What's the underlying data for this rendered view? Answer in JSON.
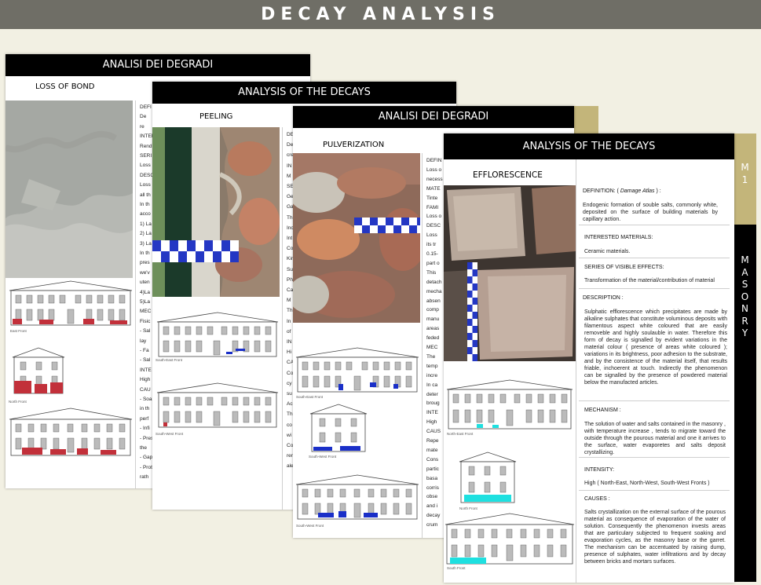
{
  "page_title": "DECAY ANALYSIS",
  "sheet1": {
    "header": "ANALISI DEI DEGRADI",
    "decay_name": "LOSS OF BOND",
    "fragments": [
      "DEFI",
      "De",
      "re",
      "INTERES",
      "Rend",
      "SERI",
      "Loss",
      "DESC",
      "Loss",
      "all th",
      "In th",
      "acco",
      "1) La",
      "2) La",
      "3) La",
      "In th",
      "pres",
      "we'v",
      "uten",
      "4)La",
      "5)La",
      "MEC",
      "Fisic",
      "- Sal",
      "lay",
      "- Fa",
      "- Sal",
      "INTE",
      "High",
      "CAU",
      "- Soa",
      "in th",
      "perf",
      "- Infi",
      "- Pres",
      "the",
      "- Gap",
      "- Prot",
      "rath"
    ],
    "captions": [
      "East Front",
      "North Front"
    ]
  },
  "sheet2": {
    "header": "ANALYSIS OF THE DECAYS",
    "decay_name": "PEELING",
    "fragments": [
      "DEFI",
      "Det",
      "cre",
      "IN",
      "M",
      "SE",
      "Ge",
      "Ga",
      "Th",
      "Inc",
      "Int",
      "Co",
      "Kin",
      "Sur",
      "Ph",
      "Ca",
      "M",
      "Th",
      "In",
      "of",
      "IN",
      "Hi",
      "CA",
      "Co",
      "cy",
      "su",
      "Ac",
      "Th",
      "co",
      "wi",
      "Co",
      "ren",
      "ale"
    ],
    "captions": [
      "South-East Front",
      "South-West Front"
    ]
  },
  "sheet3": {
    "header": "ANALISI DEI DEGRADI",
    "decay_name": "PULVERIZATION",
    "fragments": [
      "DEFIN",
      "Loss o",
      "necess",
      "MATE",
      "Tinte",
      "FAMI",
      "Loss o",
      "DESC",
      "Loss",
      "its tr",
      "0.15-",
      "part o",
      "This",
      "detach",
      "mecha",
      "absen",
      "comp",
      "manu",
      "areas",
      "feded",
      "MEC",
      "The",
      "temp",
      "incre",
      "In ca",
      "deter",
      "broug",
      "INTE",
      "High",
      "CAUS",
      "Repe",
      "mate",
      "Cons",
      "partic",
      "basa",
      "corris",
      "obse",
      "and i",
      "decay",
      "crum"
    ],
    "captions": [
      "South-East Front",
      "South-West Front",
      "South-West Front"
    ]
  },
  "sheet4": {
    "header": "ANALYSIS OF THE DECAYS",
    "decay_name": "EFFLORESCENCE",
    "side_code_letter": "M",
    "side_code_number": "1",
    "side_category": [
      "M",
      "A",
      "S",
      "O",
      "N",
      "R",
      "Y"
    ],
    "definition_label": "DEFINITION: ( ",
    "definition_source": "Damage Atlas",
    "definition_close": " ) :",
    "definition_text": "Endogenic formation of souble salts, commonly white, deposited on the surface of building materials by capillary action.",
    "materials_label": "INTERESTED MATERIALS:",
    "materials_text": "Ceramic materials.",
    "effects_label": "SERIES OF VISIBLE EFFECTS:",
    "effects_text": "Transformation of the material/contribution of material",
    "description_label": "DESCRIPTION :",
    "description_text": "Sulphatic efflorescence which precipitates are made by alkaline sulphates that constitute voluminous deposits with filamentous aspect white coloured that are easily removeble and highly soulauble in water. Therefore this form of decay is signalled by evident variations in the material colour ( presence of areas white coloured ); variations in its brightness, poor adhesion to the substrate, and by the consistence of the material itself, that results friable, inchoerent at touch. Indirectly the phenomenon can be signalled by the presence of powdered material below the manufacted articles.",
    "mechanism_label": "MECHANISM :",
    "mechanism_text": "The solution of water and salts contained in the masonry , with temperature increase , tends to migrate toward the outside through the pourous material and one it arrives to the surface, water evaporetes and salts deposit crystallizing.",
    "intensity_label": "INTENSITY:",
    "intensity_text": "High ( North-East, North-West, South-West Fronts )",
    "causes_label": "CAUSES :",
    "causes_text": "Salts crystallization on the external surface of the pourous material as consequence of evaporation of the water of solution. Consequently the phenomenon invests areas that are particulary subjected to frequent soaking and evaporation cycles, as the masonry base or the garret. The mechanism can be accentuated by raising dump, presence of sulphates, water infiltrations and by decay between bricks and mortars surfaces.",
    "captions": [
      "North-East Front",
      "North Front",
      "South Front"
    ]
  },
  "colors": {
    "topbar": "#6f6e66",
    "accent_tan": "#c3b57a",
    "header": "#000000",
    "decay_blue": "#1a2fc8",
    "efflorescence_cyan": "#1ee0e0",
    "page_bg": "#f2f0e3"
  }
}
